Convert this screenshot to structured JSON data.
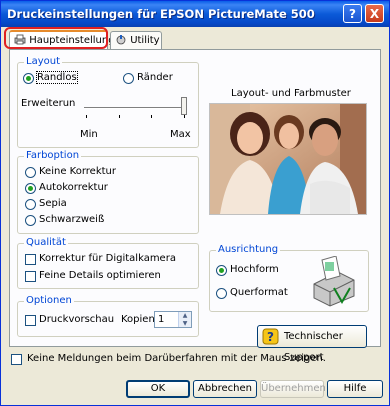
{
  "window": {
    "title": "Druckeinstellungen für EPSON PictureMate 500",
    "help_button": "?",
    "close_button": "X"
  },
  "tabs": [
    {
      "label": "Haupteinstellungen",
      "active": true
    },
    {
      "label": "Utility",
      "active": false
    }
  ],
  "layout_group": {
    "label": "Layout",
    "options": [
      {
        "label": "Randlos",
        "selected": true
      },
      {
        "label": "Ränder",
        "selected": false
      }
    ],
    "expansion_label": "Erweiterun",
    "slider_min": "Min",
    "slider_max": "Max",
    "slider_level": 1.0
  },
  "preview": {
    "label": "Layout- und Farbmuster"
  },
  "color_group": {
    "label": "Farboption",
    "options": [
      {
        "label": "Keine Korrektur",
        "selected": false
      },
      {
        "label": "Autokorrektur",
        "selected": true
      },
      {
        "label": "Sepia",
        "selected": false
      },
      {
        "label": "Schwarzweiß",
        "selected": false
      }
    ]
  },
  "quality_group": {
    "label": "Qualität",
    "options": [
      {
        "label": "Korrektur für Digitalkamera",
        "checked": false
      },
      {
        "label": "Feine Details optimieren",
        "checked": false
      }
    ]
  },
  "orientation_group": {
    "label": "Ausrichtung",
    "options": [
      {
        "label": "Hochform",
        "selected": true
      },
      {
        "label": "Querformat",
        "selected": false
      }
    ]
  },
  "options_group": {
    "label": "Optionen",
    "preview_label": "Druckvorschau",
    "preview_checked": false,
    "copies_label": "Kopien",
    "copies_value": "1"
  },
  "support_button": "Technischer Support",
  "no_messages_label": "Keine Meldungen beim Darüberfahren mit der Maus zeigen.",
  "footer": {
    "ok": "OK",
    "cancel": "Abbrechen",
    "apply": "Übernehmen",
    "help": "Hilfe"
  }
}
